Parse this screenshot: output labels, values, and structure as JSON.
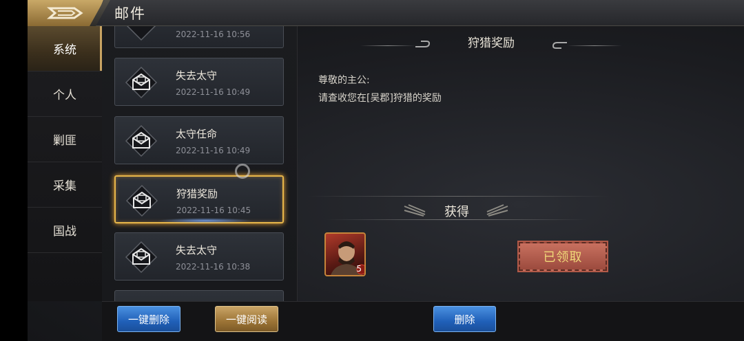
{
  "header": {
    "title": "邮件"
  },
  "sidebar": {
    "items": [
      {
        "label": "系统",
        "active": true
      },
      {
        "label": "个人",
        "active": false
      },
      {
        "label": "剿匪",
        "active": false
      },
      {
        "label": "采集",
        "active": false
      },
      {
        "label": "国战",
        "active": false
      }
    ]
  },
  "mails": [
    {
      "title": "",
      "date": "2022-11-16   10:56"
    },
    {
      "title": "失去太守",
      "date": "2022-11-16   10:49"
    },
    {
      "title": "太守任命",
      "date": "2022-11-16   10:49"
    },
    {
      "title": "狩猎奖励",
      "date": "2022-11-16   10:45"
    },
    {
      "title": "失去太守",
      "date": "2022-11-16   10:38"
    }
  ],
  "content": {
    "title": "狩猎奖励",
    "greeting": "尊敬的主公:",
    "body": "请查收您在[吴郡]狩猎的奖励",
    "obtain_label": "获得",
    "reward_count": "5",
    "claimed_label": "已领取"
  },
  "buttons": {
    "delete_all": "一键删除",
    "read_all": "一键阅读",
    "delete": "删除"
  }
}
